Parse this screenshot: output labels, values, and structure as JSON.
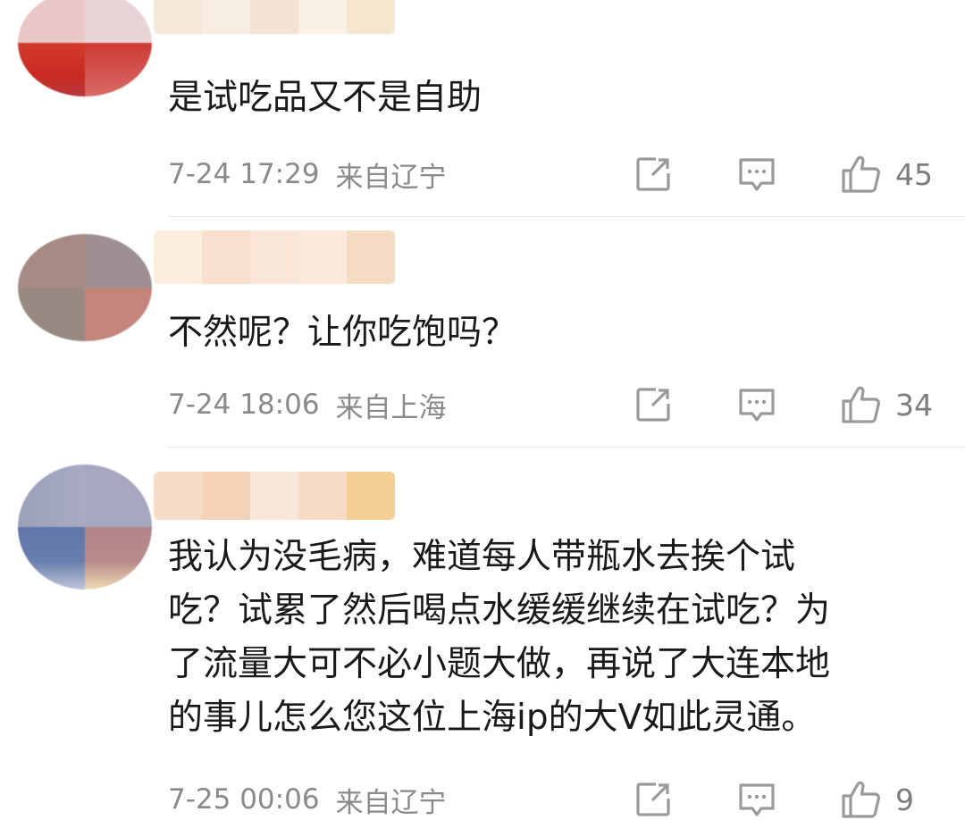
{
  "comments": [
    {
      "text": "是试吃品又不是自助",
      "time": "7-24 17:29",
      "location": "来自辽宁",
      "likes": "45",
      "avatar_colors": [
        "#efc9c9",
        "#e9d6d6",
        "#c92a22",
        "#e7b8b8",
        "#b23a3a",
        "#d9726d"
      ],
      "name_colors": [
        "#f6e7d8",
        "#f8ecdf",
        "#f4e2cf",
        "#f9eee2",
        "#f7e6cf"
      ]
    },
    {
      "text": "不然呢？让你吃饱吗？",
      "time": "7-24 18:06",
      "location": "来自上海",
      "likes": "34",
      "avatar_colors": [
        "#a78c86",
        "#a08f92",
        "#9a8a83",
        "#c3867f"
      ],
      "name_colors": [
        "#fbece0",
        "#f8e0cf",
        "#fae6d6",
        "#f9e9dc",
        "#f4dcc4"
      ]
    },
    {
      "text": "我认为没毛病，难道每人带瓶水去挨个试\n吃？试累了然后喝点水缓缓继续在试吃？为\n了流量大可不必小题大做，再说了大连本地\n的事儿怎么您这位上海ip的大V如此灵通。",
      "time": "7-25 00:06",
      "location": "来自辽宁",
      "likes": "9",
      "avatar_colors": [
        "#9aa1b7",
        "#a6a9c0",
        "#6177a8",
        "#b2878b",
        "#bcc2d8",
        "#efdcb3"
      ],
      "name_colors": [
        "#f6ddc8",
        "#f3d2b8",
        "#f8e8da",
        "#f6dcc6",
        "#f4cf95"
      ]
    }
  ]
}
